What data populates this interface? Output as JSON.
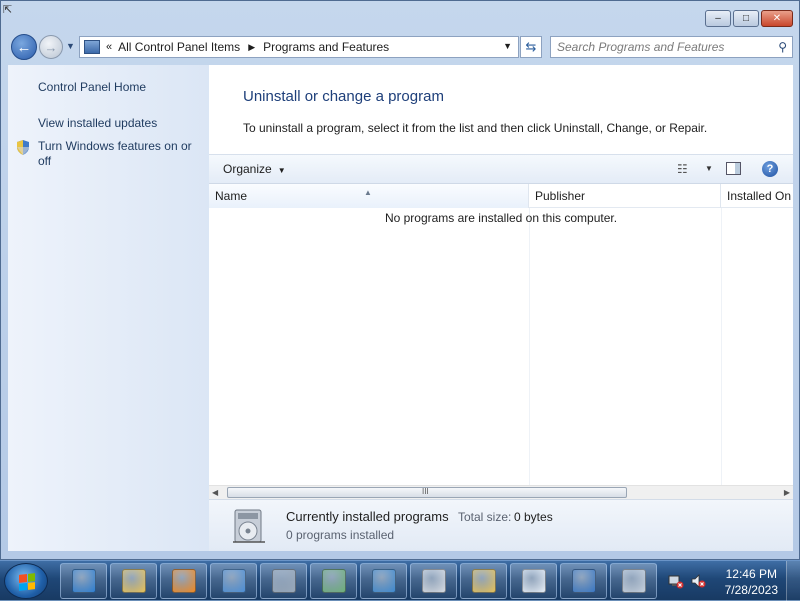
{
  "window": {
    "minimize_label": "‒",
    "maximize_label": "□",
    "close_label": "✕"
  },
  "navigation": {
    "address_chevron": "«",
    "breadcrumbs": [
      "All Control Panel Items",
      "Programs and Features"
    ],
    "search_placeholder": "Search Programs and Features"
  },
  "sidebar": {
    "items": [
      {
        "label": "Control Panel Home"
      },
      {
        "label": "View installed updates"
      },
      {
        "label": "Turn Windows features on or off"
      }
    ]
  },
  "main": {
    "title": "Uninstall or change a program",
    "description": "To uninstall a program, select it from the list and then click Uninstall, Change, or Repair.",
    "toolbar": {
      "organize_label": "Organize",
      "help_label": "?"
    },
    "columns": [
      "Name",
      "Publisher",
      "Installed On"
    ],
    "empty_message": "No programs are installed on this computer.",
    "scroll_grip": "III"
  },
  "details": {
    "title": "Currently installed programs",
    "total_size_label": "Total size:",
    "total_size_value": "0 bytes",
    "count_text": "0 programs installed"
  },
  "taskbar": {
    "pinned": [
      {
        "name": "internet-explorer",
        "color": "#2f7fd1"
      },
      {
        "name": "windows-explorer",
        "color": "#e8c35a"
      },
      {
        "name": "media-player",
        "color": "#f08a24"
      },
      {
        "name": "control-panel",
        "color": "#4d8fd6"
      },
      {
        "name": "search-tool",
        "color": "#9aa9ba"
      },
      {
        "name": "document-viewer",
        "color": "#6fb07a"
      },
      {
        "name": "network-checklist",
        "color": "#3f8ad0"
      },
      {
        "name": "mouse-settings",
        "color": "#d9dde3"
      },
      {
        "name": "folder-checklist",
        "color": "#e6c25b"
      },
      {
        "name": "blank-document",
        "color": "#e9f0f8"
      },
      {
        "name": "display-settings",
        "color": "#3a78c4"
      },
      {
        "name": "calendar-clock",
        "color": "#c8d2de"
      }
    ],
    "time": "12:46 PM",
    "date": "7/28/2023"
  }
}
